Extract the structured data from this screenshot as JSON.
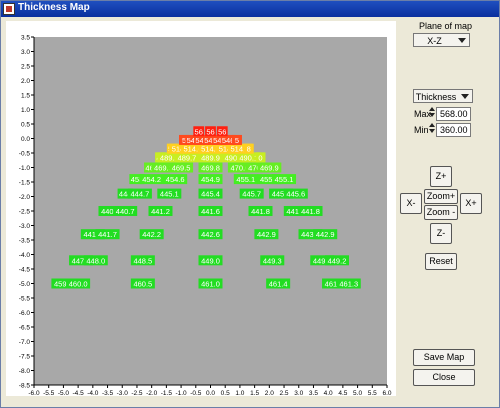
{
  "window": {
    "title": "Thickness Map",
    "app_icon": "app-icon"
  },
  "controls": {
    "plane_label": "Plane of map",
    "plane_value": "X-Z",
    "quantity_value": "Thickness",
    "max_label": "Max",
    "max_value": "568.00",
    "min_label": "Min",
    "min_value": "360.00",
    "z_plus": "Z+",
    "z_minus": "Z-",
    "x_minus": "X-",
    "x_plus": "X+",
    "zoom_plus": "Zoom+",
    "zoom_minus": "Zoom -",
    "reset": "Reset",
    "save_map": "Save Map",
    "close": "Close"
  },
  "chart_data": {
    "type": "scatter",
    "xlim": [
      -6.0,
      6.0
    ],
    "ylim": [
      -8.5,
      3.5
    ],
    "x_ticks": [
      "-6.0",
      "-5.5",
      "-5.0",
      "-4.5",
      "-4.0",
      "-3.5",
      "-3.0",
      "-2.5",
      "-2.0",
      "-1.5",
      "-1.0",
      "-0.5",
      "0.0",
      "0.5",
      "1.0",
      "1.5",
      "2.0",
      "2.5",
      "3.0",
      "3.5",
      "4.0",
      "4.5",
      "5.0",
      "5.5",
      "6.0"
    ],
    "y_ticks": [
      "3.5",
      "3.0",
      "2.5",
      "2.0",
      "1.5",
      "1.0",
      "0.5",
      "0.0",
      "-0.5",
      "-1.0",
      "-1.5",
      "-2.0",
      "-2.5",
      "-3.0",
      "-3.5",
      "-4.0",
      "-4.5",
      "-5.0",
      "-5.5",
      "-6.0",
      "-6.5",
      "-7.0",
      "-7.5",
      "-8.0",
      "-8.5"
    ],
    "plot_background": "#a8a8a8",
    "points": [
      {
        "x": -5.0,
        "y": -5.0,
        "label": "459.6",
        "color": "#22dd22"
      },
      {
        "x": -4.5,
        "y": -5.0,
        "label": "460.0",
        "color": "#22dd22"
      },
      {
        "x": -2.3,
        "y": -5.0,
        "label": "460.5",
        "color": "#22dd22"
      },
      {
        "x": 0.0,
        "y": -5.0,
        "label": "461.0",
        "color": "#22dd22"
      },
      {
        "x": 2.3,
        "y": -5.0,
        "label": "461.4",
        "color": "#22dd22"
      },
      {
        "x": 4.2,
        "y": -5.0,
        "label": "461.5",
        "color": "#22dd22"
      },
      {
        "x": 4.7,
        "y": -5.0,
        "label": "461.3",
        "color": "#22dd22"
      },
      {
        "x": -4.4,
        "y": -4.2,
        "label": "447.6",
        "color": "#22dd22"
      },
      {
        "x": -3.9,
        "y": -4.2,
        "label": "448.0",
        "color": "#22dd22"
      },
      {
        "x": -2.3,
        "y": -4.2,
        "label": "448.5",
        "color": "#22dd22"
      },
      {
        "x": 0.0,
        "y": -4.2,
        "label": "449.0",
        "color": "#22dd22"
      },
      {
        "x": 2.1,
        "y": -4.2,
        "label": "449.3",
        "color": "#22dd22"
      },
      {
        "x": 3.8,
        "y": -4.2,
        "label": "449.4",
        "color": "#22dd22"
      },
      {
        "x": 4.3,
        "y": -4.2,
        "label": "449.2",
        "color": "#22dd22"
      },
      {
        "x": -4.0,
        "y": -3.3,
        "label": "441.3",
        "color": "#22dd22"
      },
      {
        "x": -3.5,
        "y": -3.3,
        "label": "441.7",
        "color": "#22dd22"
      },
      {
        "x": -2.0,
        "y": -3.3,
        "label": "442.2",
        "color": "#22dd22"
      },
      {
        "x": 0.0,
        "y": -3.3,
        "label": "442.6",
        "color": "#22dd22"
      },
      {
        "x": 1.9,
        "y": -3.3,
        "label": "442.9",
        "color": "#22dd22"
      },
      {
        "x": 3.4,
        "y": -3.3,
        "label": "443.0",
        "color": "#22dd22"
      },
      {
        "x": 3.9,
        "y": -3.3,
        "label": "442.9",
        "color": "#22dd22"
      },
      {
        "x": -3.4,
        "y": -2.5,
        "label": "440.4",
        "color": "#22dd22"
      },
      {
        "x": -2.9,
        "y": -2.5,
        "label": "440.7",
        "color": "#22dd22"
      },
      {
        "x": -1.7,
        "y": -2.5,
        "label": "441.2",
        "color": "#22dd22"
      },
      {
        "x": 0.0,
        "y": -2.5,
        "label": "441.6",
        "color": "#22dd22"
      },
      {
        "x": 1.7,
        "y": -2.5,
        "label": "441.8",
        "color": "#22dd22"
      },
      {
        "x": 2.9,
        "y": -2.5,
        "label": "441.9",
        "color": "#22dd22"
      },
      {
        "x": 3.4,
        "y": -2.5,
        "label": "441.8",
        "color": "#22dd22"
      },
      {
        "x": -2.9,
        "y": -1.9,
        "label": "444",
        "color": "#22dd22"
      },
      {
        "x": -2.4,
        "y": -1.9,
        "label": "444.7",
        "color": "#22dd22"
      },
      {
        "x": -1.4,
        "y": -1.9,
        "label": "445.1",
        "color": "#22dd22"
      },
      {
        "x": 0.0,
        "y": -1.9,
        "label": "445.4",
        "color": "#22dd22"
      },
      {
        "x": 1.4,
        "y": -1.9,
        "label": "445.7",
        "color": "#22dd22"
      },
      {
        "x": 2.4,
        "y": -1.9,
        "label": "445.7",
        "color": "#22dd22"
      },
      {
        "x": 2.9,
        "y": -1.9,
        "label": "445.6",
        "color": "#22dd22"
      },
      {
        "x": -2.5,
        "y": -1.4,
        "label": "453",
        "color": "#44ee22"
      },
      {
        "x": -2.0,
        "y": -1.4,
        "label": "454.2",
        "color": "#44ee22"
      },
      {
        "x": -1.2,
        "y": -1.4,
        "label": "454.6",
        "color": "#44ee22"
      },
      {
        "x": 0.0,
        "y": -1.4,
        "label": "454.9",
        "color": "#44ee22"
      },
      {
        "x": 1.2,
        "y": -1.4,
        "label": "455.1",
        "color": "#44ee22"
      },
      {
        "x": 2.0,
        "y": -1.4,
        "label": "455.2",
        "color": "#44ee22"
      },
      {
        "x": 2.5,
        "y": -1.4,
        "label": "455.1",
        "color": "#44ee22"
      },
      {
        "x": -2.0,
        "y": -1.0,
        "label": "464",
        "color": "#66ee22"
      },
      {
        "x": -1.6,
        "y": -1.0,
        "label": "469.3",
        "color": "#66ee22"
      },
      {
        "x": -1.0,
        "y": -1.0,
        "label": "469.5",
        "color": "#66ee22"
      },
      {
        "x": 0.0,
        "y": -1.0,
        "label": "469.8",
        "color": "#66ee22"
      },
      {
        "x": 1.0,
        "y": -1.0,
        "label": "470.0",
        "color": "#66ee22"
      },
      {
        "x": 1.6,
        "y": -1.0,
        "label": "470.0",
        "color": "#66ee22"
      },
      {
        "x": 2.0,
        "y": -1.0,
        "label": "469.9",
        "color": "#66ee22"
      },
      {
        "x": -1.7,
        "y": -0.65,
        "label": "48",
        "color": "#c8ee22"
      },
      {
        "x": -1.4,
        "y": -0.65,
        "label": "489.5",
        "color": "#c8ee22"
      },
      {
        "x": -0.8,
        "y": -0.65,
        "label": "489.7",
        "color": "#c8ee22"
      },
      {
        "x": 0.0,
        "y": -0.65,
        "label": "489.9",
        "color": "#c8ee22"
      },
      {
        "x": 0.8,
        "y": -0.65,
        "label": "490.0",
        "color": "#c8ee22"
      },
      {
        "x": 1.3,
        "y": -0.65,
        "label": "490.1",
        "color": "#c8ee22"
      },
      {
        "x": 1.7,
        "y": -0.65,
        "label": "0",
        "color": "#c8ee22"
      },
      {
        "x": -1.3,
        "y": -0.35,
        "label": "51",
        "color": "#ffd020"
      },
      {
        "x": -1.0,
        "y": -0.35,
        "label": "514.5",
        "color": "#ffd020"
      },
      {
        "x": -0.6,
        "y": -0.35,
        "label": "514.6",
        "color": "#ffd020"
      },
      {
        "x": 0.0,
        "y": -0.35,
        "label": "514.7",
        "color": "#ffd020"
      },
      {
        "x": 0.6,
        "y": -0.35,
        "label": "514.8",
        "color": "#ffd020"
      },
      {
        "x": 1.0,
        "y": -0.35,
        "label": "514.8",
        "color": "#ffd020"
      },
      {
        "x": 1.3,
        "y": -0.35,
        "label": "8",
        "color": "#ffd020"
      },
      {
        "x": -0.9,
        "y": -0.05,
        "label": "5",
        "color": "#ff4a1e"
      },
      {
        "x": -0.6,
        "y": -0.05,
        "label": "546",
        "color": "#ff4a1e"
      },
      {
        "x": -0.3,
        "y": -0.05,
        "label": "546",
        "color": "#ff4a1e"
      },
      {
        "x": 0.0,
        "y": -0.05,
        "label": "546",
        "color": "#ff4a1e"
      },
      {
        "x": 0.3,
        "y": -0.05,
        "label": "546",
        "color": "#ff4a1e"
      },
      {
        "x": 0.6,
        "y": -0.05,
        "label": "546",
        "color": "#ff4a1e"
      },
      {
        "x": 0.9,
        "y": -0.05,
        "label": "5",
        "color": "#ff4a1e"
      },
      {
        "x": -0.4,
        "y": 0.25,
        "label": "56",
        "color": "#ff2010"
      },
      {
        "x": 0.0,
        "y": 0.25,
        "label": "56",
        "color": "#ff2010"
      },
      {
        "x": 0.4,
        "y": 0.25,
        "label": "56",
        "color": "#ff2010"
      }
    ]
  }
}
